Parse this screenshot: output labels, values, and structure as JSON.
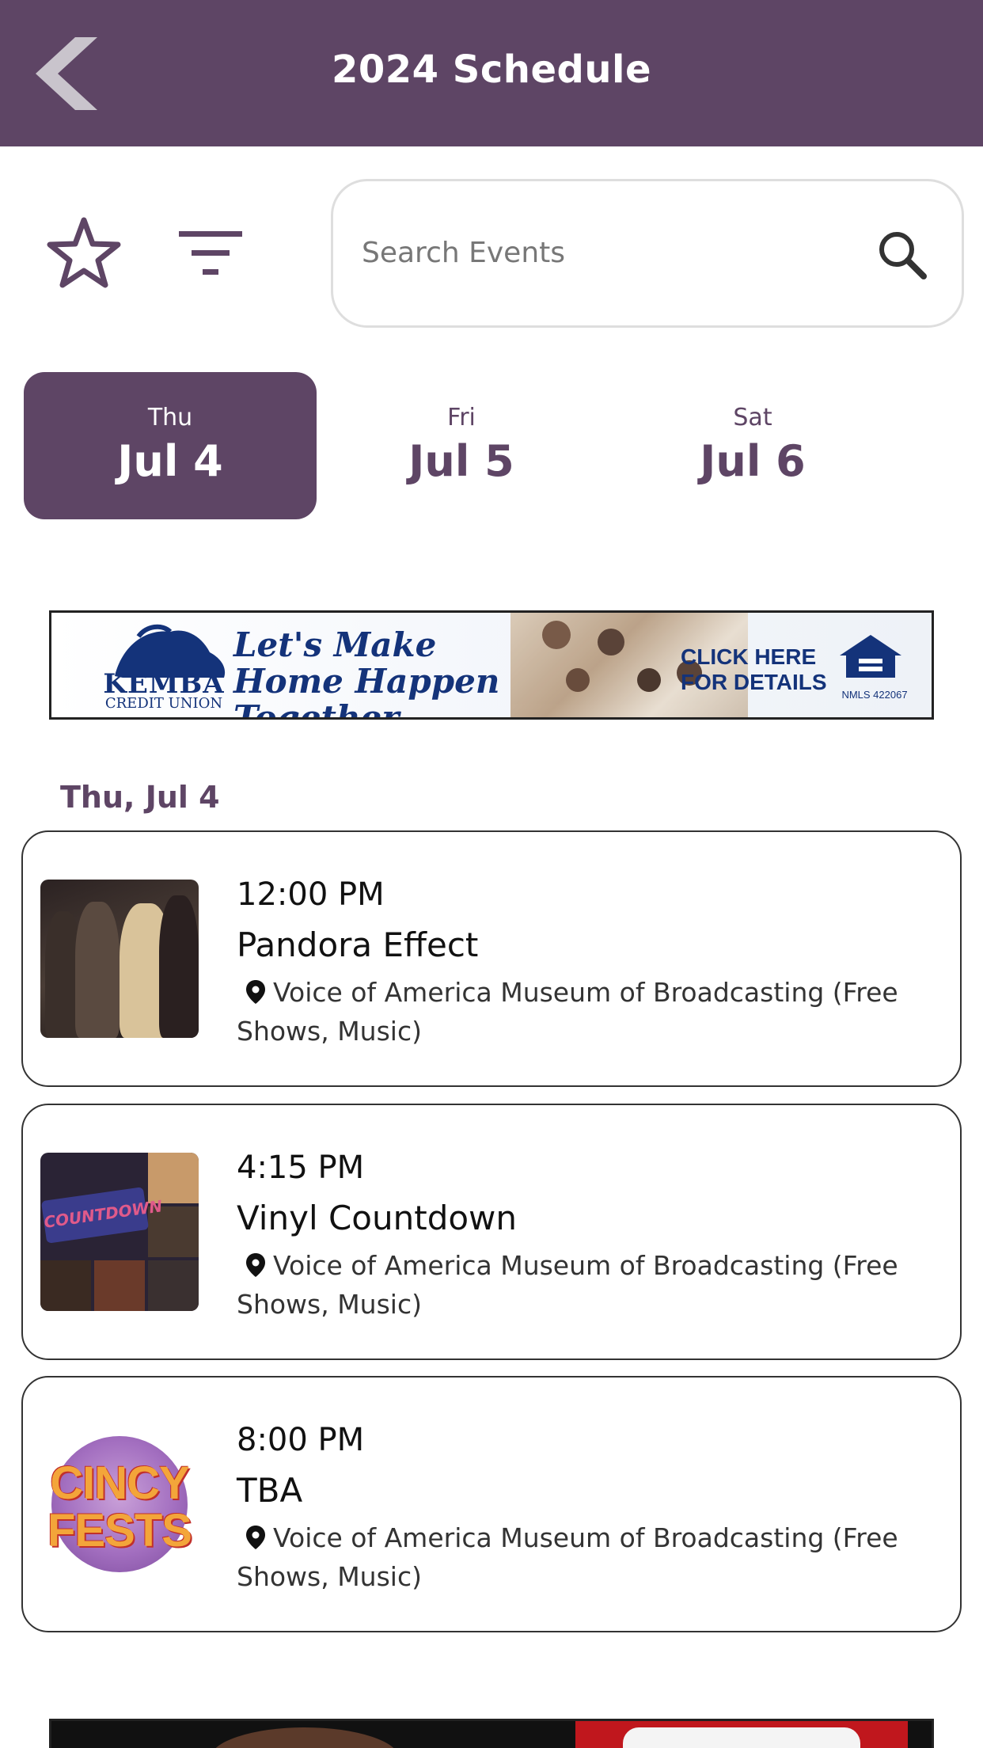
{
  "header": {
    "title": "2024 Schedule",
    "back_icon": "chevron-left-icon",
    "background": "#5e4565"
  },
  "toolbar": {
    "favorites_icon": "star-outline-icon",
    "filter_icon": "filter-lines-icon",
    "search_placeholder": "Search Events",
    "search_value": "",
    "search_icon": "magnifier-icon"
  },
  "days": [
    {
      "dow": "Thu",
      "date": "Jul 4",
      "active": true
    },
    {
      "dow": "Fri",
      "date": "Jul 5",
      "active": false
    },
    {
      "dow": "Sat",
      "date": "Jul 6",
      "active": false
    }
  ],
  "ad_top": {
    "brand": "KEMBA",
    "brand_sub": "CREDIT UNION",
    "tagline": "Let's Make Home Happen Together",
    "cta": "CLICK HERE FOR DETAILS",
    "nmls": "NMLS 422067"
  },
  "section": {
    "date_heading": "Thu, Jul 4"
  },
  "events": [
    {
      "time": "12:00 PM",
      "title": "Pandora Effect",
      "location": "Voice of America Museum of Broadcasting (Free Shows, Music)"
    },
    {
      "time": "4:15 PM",
      "title": "Vinyl Countdown",
      "location": "Voice of America Museum of Broadcasting (Free Shows, Music)",
      "thumb_logo": "COUNTDOWN"
    },
    {
      "time": "8:00 PM",
      "title": "TBA",
      "location": "Voice of America Museum of Broadcasting (Free Shows, Music)",
      "thumb_logo_1": "CINCY",
      "thumb_logo_2": "FESTS"
    }
  ],
  "colors": {
    "brand": "#5e4565",
    "card_border": "#333333"
  }
}
